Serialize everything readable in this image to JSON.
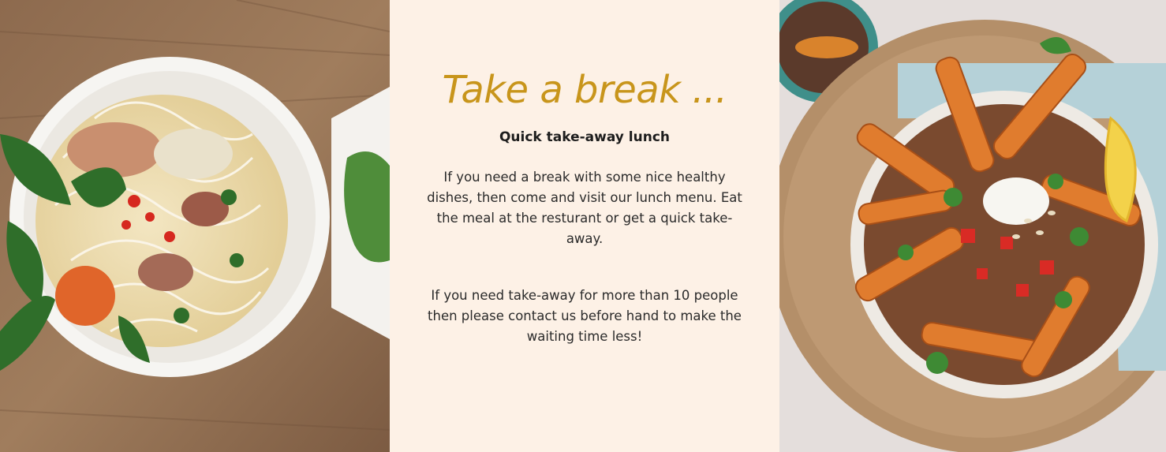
{
  "lunch_section": {
    "headline": "Take a break ...",
    "subheading": "Quick take-away lunch",
    "paragraph_1": "If you need a break with some nice healthy dishes, then come and visit our lunch menu. Eat the meal at the resturant or get a quick take-away.",
    "paragraph_2": "If you need take-away for more than 10 people then please contact us before hand to make the waiting time less!",
    "accent_color": "#c8951b",
    "panel_background": "#fdf1e6"
  }
}
